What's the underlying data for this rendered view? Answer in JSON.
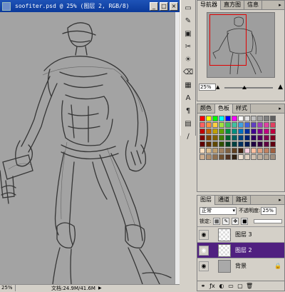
{
  "document": {
    "title": "soofiter.psd @ 25% (图层 2, RGB/8)",
    "window_buttons": [
      "_",
      "□",
      "×"
    ],
    "status_zoom": "25%",
    "status_info": "文档:24.9M/41.6M",
    "status_arrow": "▶"
  },
  "toolbox": {
    "tools": [
      {
        "name": "slice-tool",
        "glyph": "▭"
      },
      {
        "name": "brush-tool",
        "glyph": "✎"
      },
      {
        "name": "stamp-tool",
        "glyph": "▣"
      },
      {
        "name": "crop-tool",
        "glyph": "✂"
      },
      {
        "name": "bulb-tool",
        "glyph": "☀"
      },
      {
        "name": "eraser-tool",
        "glyph": "⌫"
      },
      {
        "name": "gradient-tool",
        "glyph": "▦"
      },
      {
        "name": "type-tool",
        "glyph": "A"
      },
      {
        "name": "pen-tool",
        "glyph": "¶"
      },
      {
        "name": "notes-tool",
        "glyph": "▤"
      },
      {
        "name": "eyedropper-tool",
        "glyph": "∕"
      }
    ]
  },
  "navigator": {
    "tabs": [
      "导航器",
      "直方图",
      "信息"
    ],
    "zoom": "25%",
    "zoom_level": 0.42,
    "menu": "▸"
  },
  "color": {
    "tabs": [
      "颜色",
      "色板",
      "样式"
    ],
    "active_tab": 1,
    "menu": "▸",
    "swatch_colors": [
      "#ff0000",
      "#ffff00",
      "#00ff00",
      "#00ffff",
      "#0000ff",
      "#ff00ff",
      "#ffffff",
      "#e0e0e0",
      "#c0c0c0",
      "#a0a0a0",
      "#808080",
      "#606060",
      "#ff6060",
      "#ff9040",
      "#ffd040",
      "#a0e040",
      "#40c060",
      "#40c0a0",
      "#40a0e0",
      "#4060e0",
      "#6040c0",
      "#a040c0",
      "#e040a0",
      "#e04060",
      "#c00000",
      "#c06000",
      "#c0a000",
      "#60a000",
      "#009040",
      "#009080",
      "#0070c0",
      "#0030a0",
      "#400090",
      "#800090",
      "#c00080",
      "#c00040",
      "#800000",
      "#804000",
      "#806000",
      "#408000",
      "#006030",
      "#006060",
      "#004080",
      "#002070",
      "#300060",
      "#500060",
      "#800050",
      "#800020",
      "#600000",
      "#603000",
      "#604800",
      "#305000",
      "#004020",
      "#004040",
      "#003060",
      "#001850",
      "#200040",
      "#380040",
      "#600040",
      "#600010",
      "#ffe0c0",
      "#e0c090",
      "#c0a070",
      "#a08060",
      "#806040",
      "#604020",
      "#402010",
      "#ffd0e0",
      "#ffc0a0",
      "#e0a080",
      "#c08060",
      "#a06040",
      "#d0b090",
      "#b09070",
      "#907050",
      "#705030",
      "#503020",
      "#302010",
      "#f0e0d0",
      "#e0d0c0",
      "#d0c0b0",
      "#c0b0a0",
      "#b0a090",
      "#a09080"
    ]
  },
  "layers": {
    "tabs": [
      "图层",
      "通道",
      "路径"
    ],
    "menu": "▸",
    "blend_mode": "正常",
    "opacity_label": "不透明度:",
    "opacity": "25%",
    "lock_label": "锁定:",
    "list": [
      {
        "name": "图层 3",
        "visible": true,
        "selected": false,
        "thumb": "check",
        "lock": ""
      },
      {
        "name": "图层 2",
        "visible": true,
        "selected": true,
        "thumb": "check",
        "lock": ""
      },
      {
        "name": "背景",
        "visible": true,
        "selected": false,
        "thumb": "solid",
        "lock": "🔒"
      }
    ],
    "footer_icons": [
      "⚭",
      "ƒx",
      "◐",
      "▭",
      "▢",
      "🗑"
    ]
  },
  "colors": {
    "title_bar": "#0b3a9a",
    "canvas_bg": "#a3a3a3",
    "selected_layer": "#502080",
    "navigator_rect": "#e00000"
  }
}
